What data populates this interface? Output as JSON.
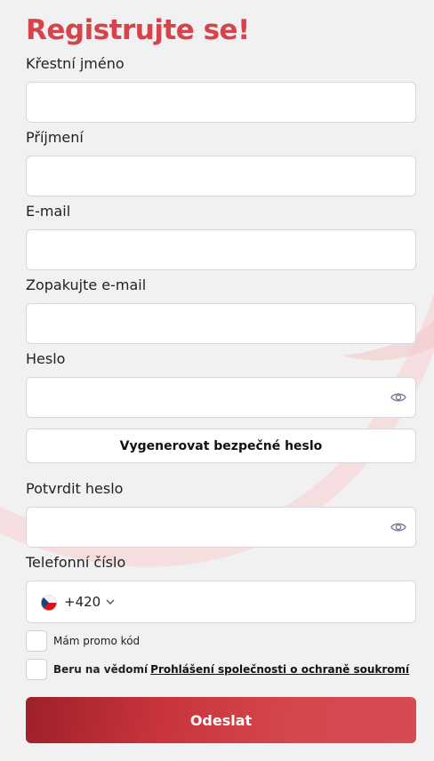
{
  "form": {
    "title": "Registrujte se!",
    "first_name_label": "Křestní jméno",
    "last_name_label": "Příjmení",
    "email_label": "E-mail",
    "email_repeat_label": "Zopakujte e-mail",
    "password_label": "Heslo",
    "generate_password_button": "Vygenerovat bezpečné heslo",
    "confirm_password_label": "Potvrdit heslo",
    "phone_label": "Telefonní číslo",
    "phone_country_code": "+420",
    "promo_code_label": "Mám promo kód",
    "privacy_prefix": "Beru na vědomí",
    "privacy_link": "Prohlášení společnosti o ochraně soukromí",
    "submit_button": "Odeslat"
  },
  "icons": {
    "password_toggle": "eye-icon",
    "country_flag": "czech-flag-icon",
    "country_dropdown": "chevron-down-icon"
  },
  "colors": {
    "accent": "#d6434b",
    "submit_dark": "#9e2029",
    "background": "#f1f1f1"
  }
}
